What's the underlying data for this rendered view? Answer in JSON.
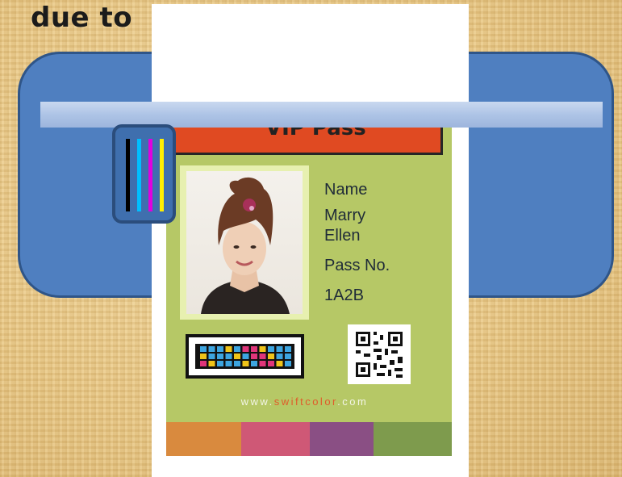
{
  "headline": "due to",
  "card": {
    "header_title": "VIP Pass",
    "name_label": "Name",
    "name_value_line1": "Marry",
    "name_value_line2": "Ellen",
    "pass_label": "Pass No.",
    "pass_value": "1A2B",
    "url_prefix": "www.",
    "url_brand": "swiftcolor",
    "url_suffix": ".com"
  },
  "colors": {
    "printer_body": "#4f7fc0",
    "card_background": "#b6c866",
    "header_red": "#e04a22",
    "ink_black": "#000000",
    "ink_cyan": "#00bfff",
    "ink_magenta": "#e000e0",
    "ink_yellow": "#ffee00",
    "swatches": [
      "#d98a3e",
      "#cf5876",
      "#8a4f84",
      "#7e9b4d"
    ]
  },
  "icons": {
    "cartridge": "ink-cartridge-icon",
    "barcode": "color-barcode-icon",
    "qr": "qr-code-icon"
  }
}
